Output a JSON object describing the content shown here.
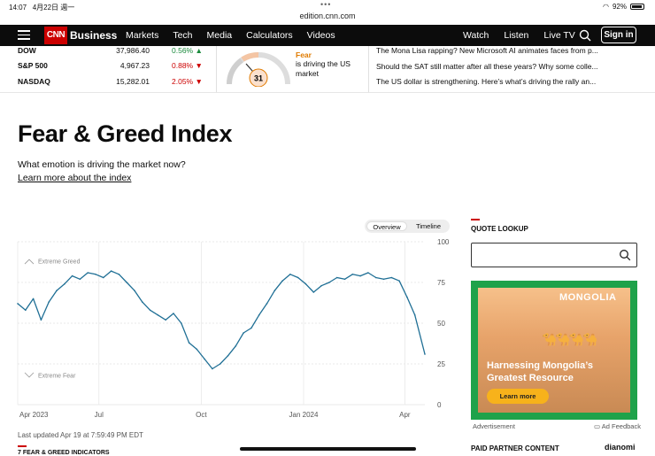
{
  "status": {
    "time": "14:07",
    "date": "4月22日 週一",
    "battery": "92%",
    "battery_level": 0.92
  },
  "browser": {
    "url": "edition.cnn.com"
  },
  "nav": {
    "logo": "CNN",
    "brand": "Business",
    "links": [
      "Markets",
      "Tech",
      "Media",
      "Calculators",
      "Videos"
    ],
    "right_links": [
      "Watch",
      "Listen",
      "Live TV"
    ],
    "signin": "Sign in"
  },
  "markets": [
    {
      "name": "DOW",
      "value": "37,986.40",
      "change": "0.56%",
      "direction": "up"
    },
    {
      "name": "S&P 500",
      "value": "4,967.23",
      "change": "0.88%",
      "direction": "down"
    },
    {
      "name": "NASDAQ",
      "value": "15,282.01",
      "change": "2.05%",
      "direction": "down"
    }
  ],
  "fear_widget": {
    "value": "31",
    "label": "Fear",
    "description": "is driving the US market"
  },
  "headlines": [
    "The Mona Lisa rapping? New Microsoft AI animates faces from p...",
    "Should the SAT still matter after all these years? Why some colle...",
    "The US dollar is strengthening. Here’s what’s driving the rally an..."
  ],
  "page": {
    "title": "Fear & Greed Index",
    "subtitle": "What emotion is driving the market now?",
    "learn_more": "Learn more about the index",
    "updated": "Last updated Apr 19 at 7:59:49 PM EDT",
    "indicators_heading": "7 FEAR & GREED INDICATORS"
  },
  "toggle": {
    "options": [
      "Overview",
      "Timeline"
    ],
    "active": "Overview"
  },
  "chart_data": {
    "type": "line",
    "title": "",
    "xlabel": "",
    "ylabel": "",
    "x_ticks": [
      "Apr 2023",
      "Jul",
      "Oct",
      "Jan 2024",
      "Apr"
    ],
    "y_ticks": [
      0,
      25,
      50,
      75,
      100
    ],
    "ylim": [
      0,
      100
    ],
    "annotations": [
      "Extreme Greed",
      "Extreme Fear"
    ],
    "series": [
      {
        "x": [
          "2023-04-19",
          "2023-04-26",
          "2023-05-03",
          "2023-05-10",
          "2023-05-17",
          "2023-05-24",
          "2023-05-31",
          "2023-06-07",
          "2023-06-14",
          "2023-06-21",
          "2023-06-28",
          "2023-07-05",
          "2023-07-12",
          "2023-07-19",
          "2023-07-26",
          "2023-08-02",
          "2023-08-09",
          "2023-08-16",
          "2023-08-23",
          "2023-08-30",
          "2023-09-06",
          "2023-09-13",
          "2023-09-20",
          "2023-09-27",
          "2023-10-04",
          "2023-10-11",
          "2023-10-18",
          "2023-10-25",
          "2023-11-01",
          "2023-11-08",
          "2023-11-15",
          "2023-11-22",
          "2023-11-29",
          "2023-12-06",
          "2023-12-13",
          "2023-12-20",
          "2023-12-27",
          "2024-01-03",
          "2024-01-10",
          "2024-01-17",
          "2024-01-24",
          "2024-01-31",
          "2024-02-07",
          "2024-02-14",
          "2024-02-21",
          "2024-02-28",
          "2024-03-06",
          "2024-03-13",
          "2024-03-20",
          "2024-03-27",
          "2024-04-03",
          "2024-04-10",
          "2024-04-19"
        ],
        "values": [
          62,
          58,
          65,
          52,
          63,
          70,
          74,
          79,
          77,
          81,
          80,
          78,
          82,
          80,
          75,
          70,
          63,
          58,
          55,
          52,
          56,
          50,
          38,
          34,
          28,
          22,
          25,
          30,
          36,
          44,
          47,
          55,
          62,
          70,
          76,
          80,
          78,
          74,
          69,
          73,
          75,
          78,
          77,
          80,
          79,
          81,
          78,
          77,
          78,
          76,
          66,
          55,
          31
        ]
      }
    ],
    "line_color": "#1f6f95"
  },
  "quote_lookup": {
    "title": "QUOTE LOOKUP",
    "placeholder": ""
  },
  "ad": {
    "brand": "MONGOLIA",
    "headline": "Harnessing Mongolia’s Greatest Resource",
    "cta": "Learn more",
    "label": "Advertisement",
    "feedback": "Ad Feedback"
  },
  "paid": {
    "title": "PAID PARTNER CONTENT",
    "sponsor": "dianomi"
  },
  "colors": {
    "accent": "#cc0000",
    "up": "#1a8a3c",
    "fear": "#e07b00"
  }
}
